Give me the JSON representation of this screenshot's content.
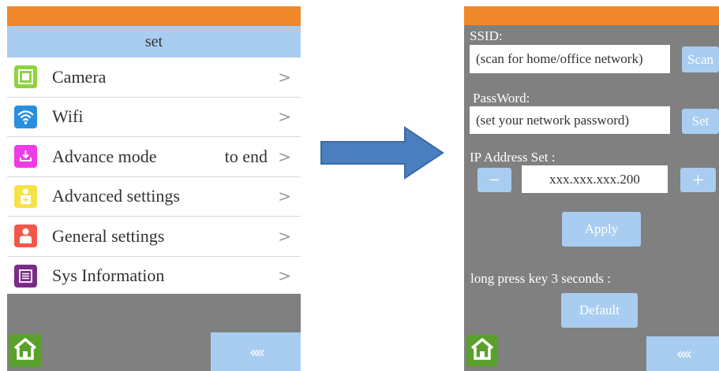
{
  "left": {
    "title": "set",
    "menu": [
      {
        "label": "Camera",
        "extra": "",
        "icon": "camera-icon",
        "color": "#8ed43a"
      },
      {
        "label": "Wifi",
        "extra": "",
        "icon": "wifi-icon",
        "color": "#2a8ee0"
      },
      {
        "label": "Advance mode",
        "extra": "to end",
        "icon": "download-icon",
        "color": "#f03ce6"
      },
      {
        "label": "Advanced settings",
        "extra": "",
        "icon": "advanced-settings-icon",
        "color": "#f5e346"
      },
      {
        "label": "General settings",
        "extra": "",
        "icon": "user-icon",
        "color": "#f2584a"
      },
      {
        "label": "Sys Information",
        "extra": "",
        "icon": "document-icon",
        "color": "#7a2c86"
      }
    ],
    "chevron": ">",
    "back_label": "««"
  },
  "right": {
    "ssid_label": "SSID:",
    "ssid_placeholder": "(scan for home/office network)",
    "scan_label": "Scan",
    "password_label": "PassWord:",
    "password_placeholder": "(set your network password)",
    "set_label": "Set",
    "ip_label": "IP Address Set :",
    "ip_value": "xxx.xxx.xxx.200",
    "minus_label": "−",
    "plus_label": "+",
    "apply_label": "Apply",
    "long_press_label": "long press key 3 seconds :",
    "default_label": "Default",
    "back_label": "««"
  },
  "colors": {
    "orange": "#f0882c",
    "light_blue": "#a9cdf0",
    "gray": "#808080",
    "home_green": "#5aa02c",
    "arrow_blue": "#4a7fbf"
  }
}
